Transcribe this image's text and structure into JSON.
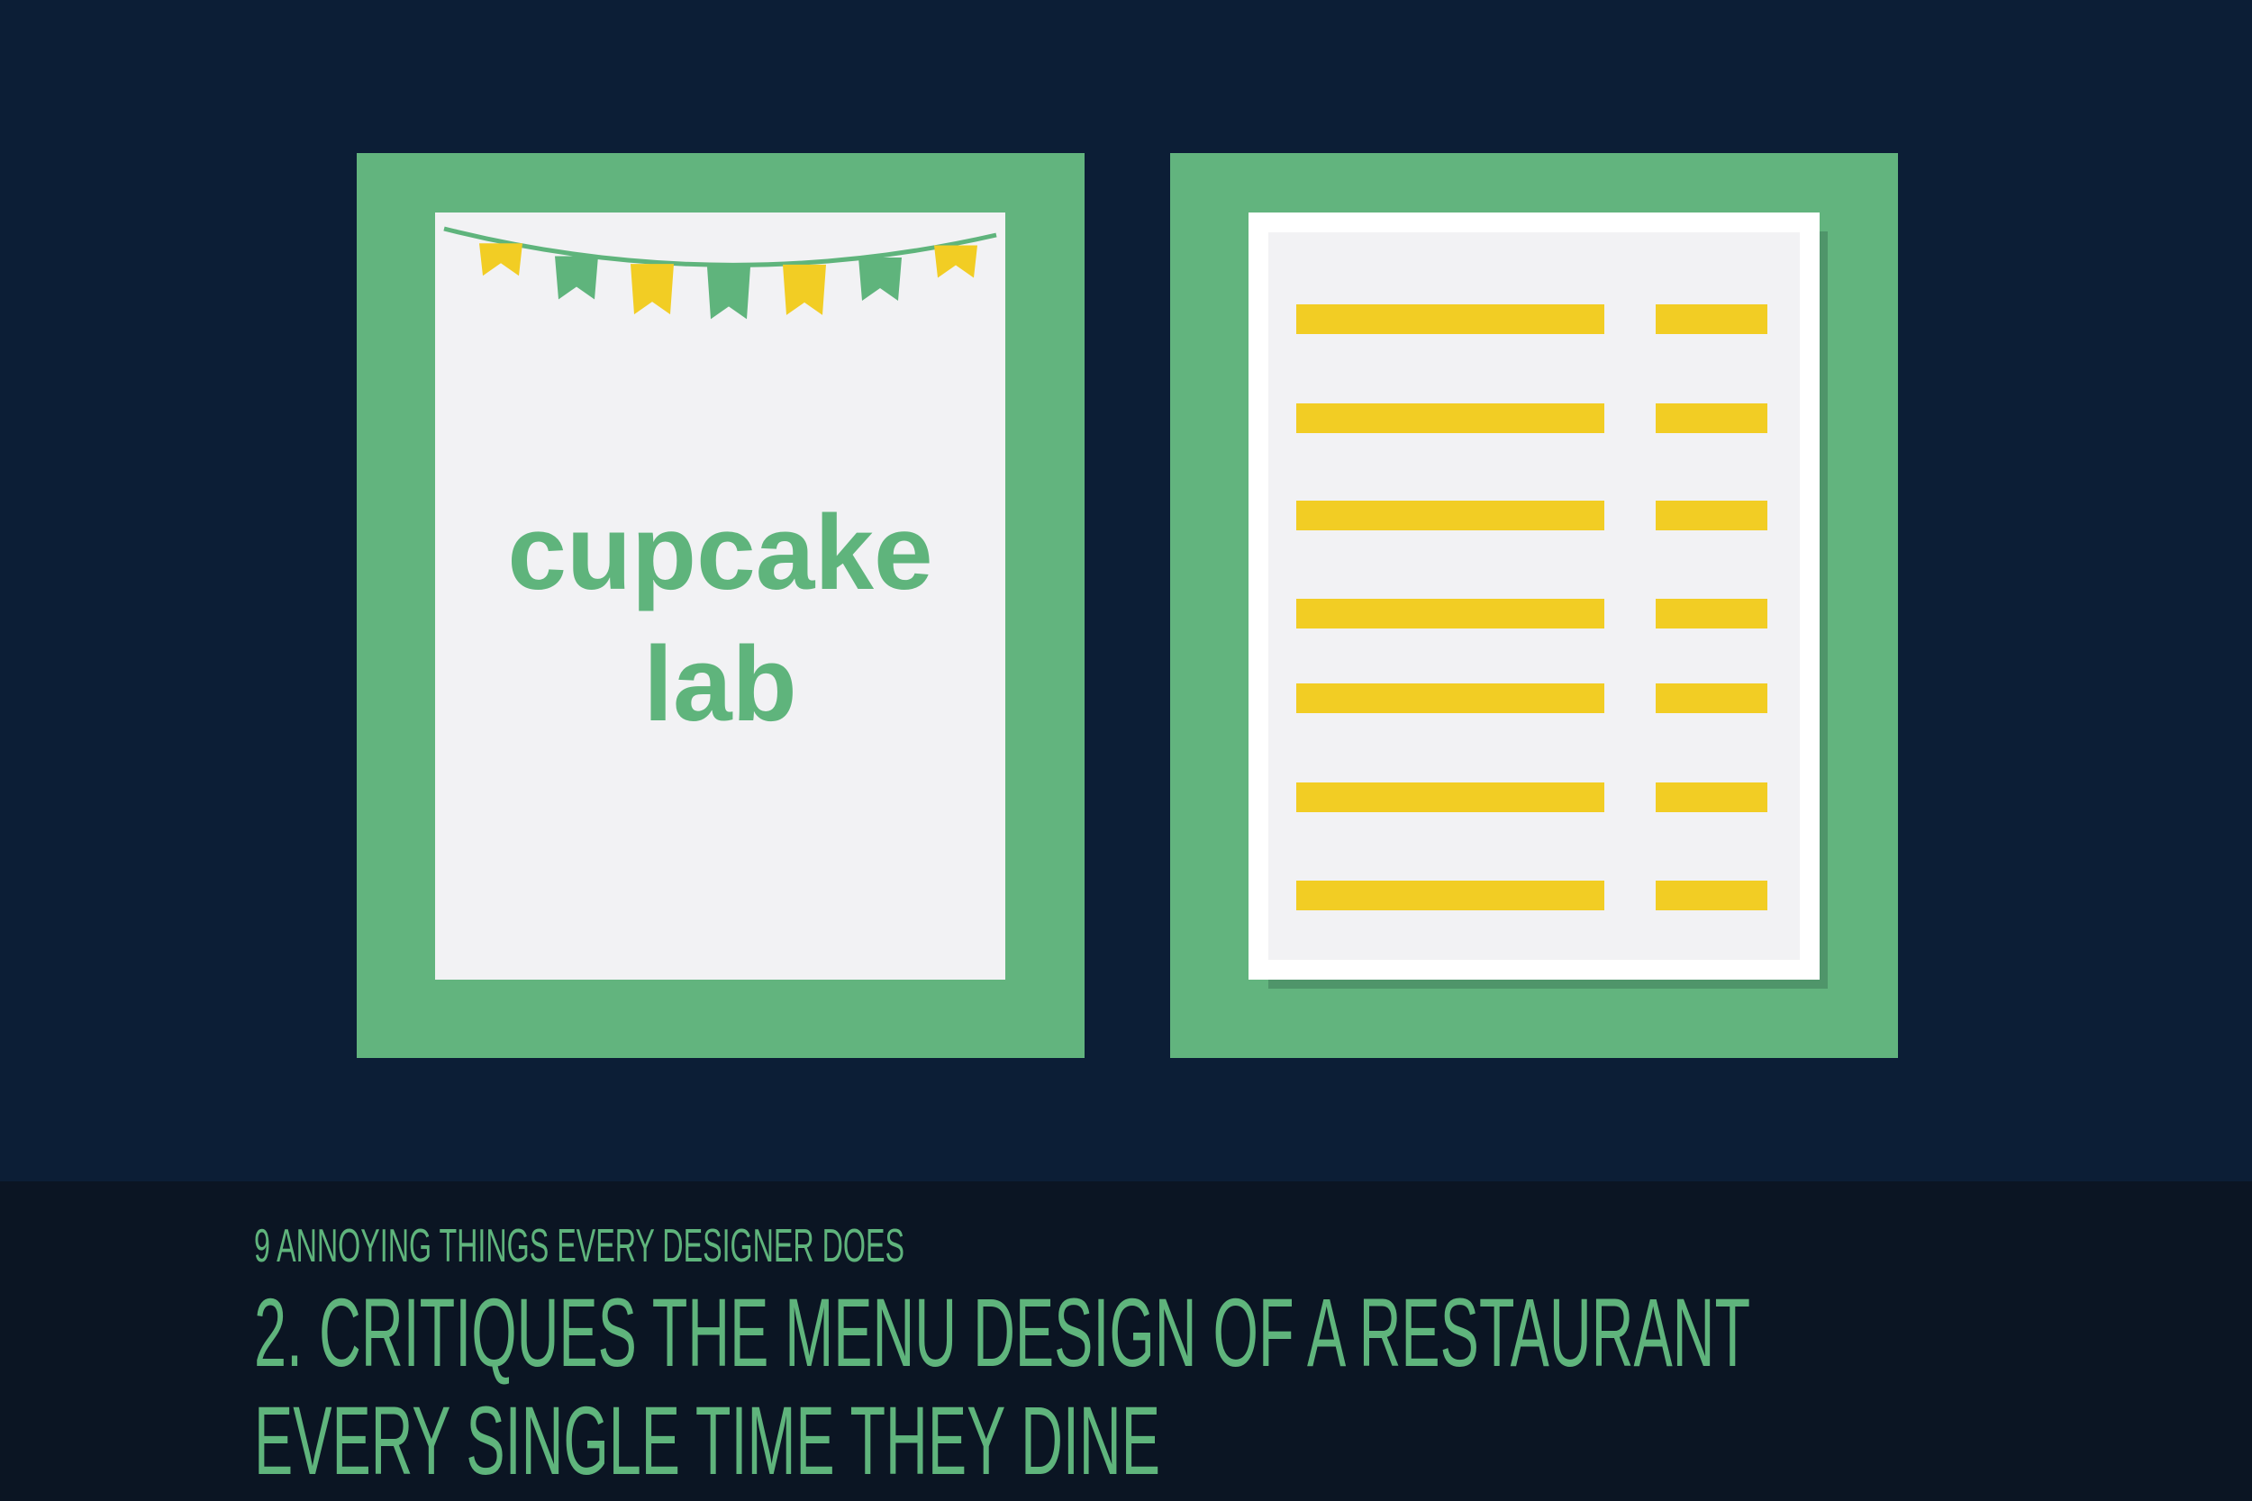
{
  "menu_cover": {
    "brand_line1": "cupcake",
    "brand_line2": "lab",
    "bunting_flag_colors": [
      "#f2cd24",
      "#5fb47c",
      "#f2cd24",
      "#5fb47c",
      "#f2cd24",
      "#5fb47c",
      "#f2cd24"
    ]
  },
  "menu_inner": {
    "line_color": "#f2cd24",
    "row_count": 7
  },
  "caption": {
    "kicker": "9 ANNOYING THINGS EVERY DESIGNER DOES",
    "title_line1": "2. CRITIQUES THE MENU DESIGN OF A RESTAURANT",
    "title_line2": "EVERY SINGLE TIME THEY DINE"
  },
  "colors": {
    "background": "#0c1e36",
    "caption_band": "#0b1523",
    "panel_green": "#62b47e",
    "accent_green": "#5fb47c",
    "accent_yellow": "#f2cd24"
  }
}
